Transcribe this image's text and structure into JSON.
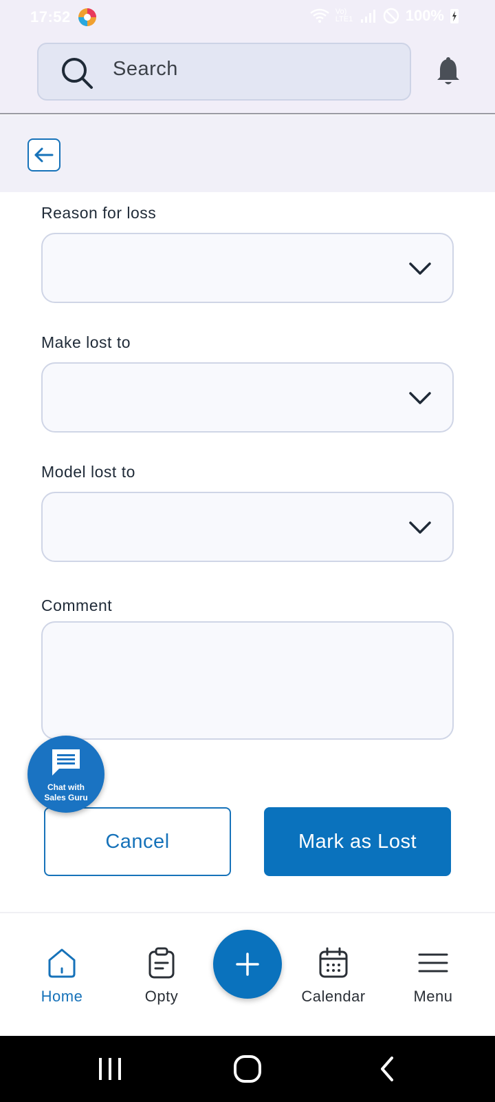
{
  "status_bar": {
    "time": "17:52",
    "network": "Vo) LTE1",
    "battery": "100%"
  },
  "search": {
    "placeholder": "Search"
  },
  "form": {
    "reason_label": "Reason for loss",
    "make_label": "Make lost to",
    "model_label": "Model lost to",
    "comment_label": "Comment"
  },
  "actions": {
    "cancel_label": "Cancel",
    "lost_label": "Mark as Lost"
  },
  "chat_fab": {
    "line1": "Chat with",
    "line2": "Sales Guru"
  },
  "bottom_nav": {
    "items": [
      {
        "label": "Home",
        "icon": "home-icon",
        "active": true
      },
      {
        "label": "Opty",
        "icon": "clipboard-icon"
      },
      {
        "label": "Calendar",
        "icon": "calendar-icon"
      },
      {
        "label": "Menu",
        "icon": "hamburger-icon"
      }
    ]
  },
  "colors": {
    "accent": "#0a72bd",
    "header_bg": "#f1eef8",
    "field_bg": "#f8f9fd"
  }
}
